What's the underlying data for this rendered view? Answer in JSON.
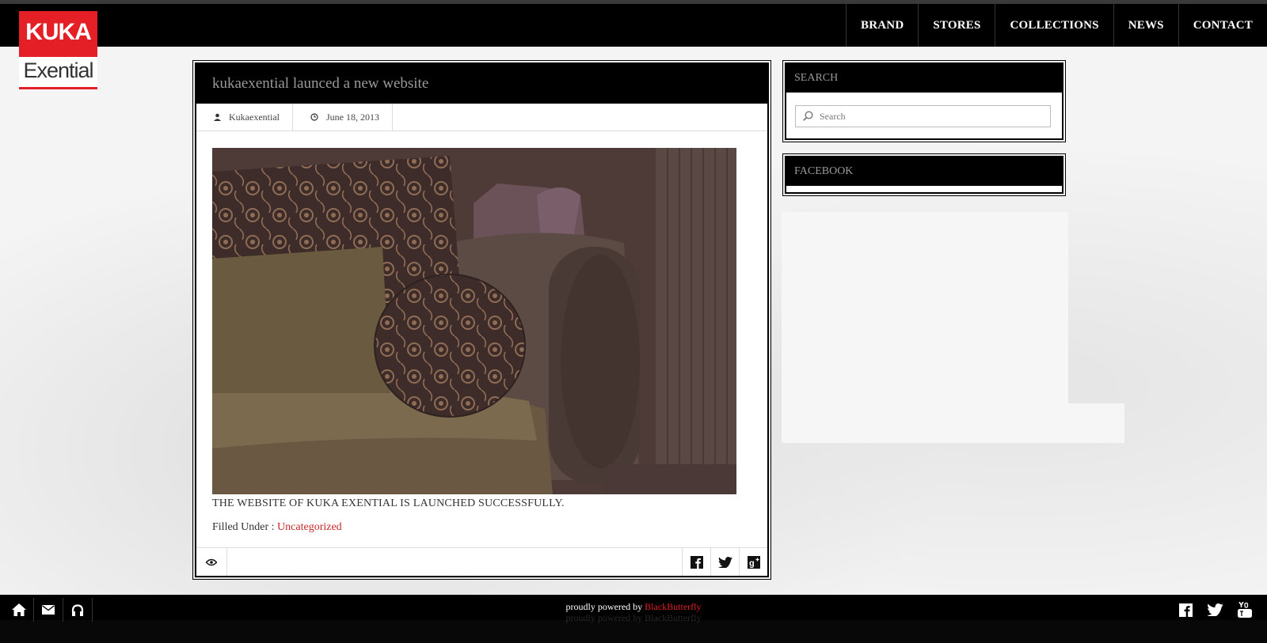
{
  "logo": {
    "top_text": "KUKA",
    "bottom_text": "Exential"
  },
  "nav": {
    "items": [
      "BRAND",
      "STORES",
      "COLLECTIONS",
      "NEWS",
      "CONTACT"
    ]
  },
  "post": {
    "title": "kukaexential launced a new website",
    "author": "Kukaexential",
    "date": "June 18, 2013",
    "excerpt": "THE WEBSITE OF KUKA EXENTIAL IS LAUNCHED SUCCESSFULLY.",
    "filed_label": "Filled Under :",
    "category": "Uncategorized"
  },
  "sidebar": {
    "search_title": "SEARCH",
    "search_placeholder": "Search",
    "facebook_title": "FACEBOOK"
  },
  "footer": {
    "powered_prefix": "proudly powered by",
    "powered_brand": "BlackButterfly"
  },
  "colors": {
    "accent": "#e41f26",
    "header_bg": "#000000",
    "photo_tint": "#4e3b38"
  },
  "icons": {
    "post_author": "user-icon",
    "post_date": "clock-icon",
    "views": "eye-icon",
    "share": [
      "facebook-icon",
      "twitter-icon",
      "google-plus-icon"
    ],
    "footer_left": [
      "home-icon",
      "mail-icon",
      "headphones-icon"
    ],
    "footer_right": [
      "facebook-icon",
      "twitter-icon",
      "youtube-icon"
    ]
  }
}
